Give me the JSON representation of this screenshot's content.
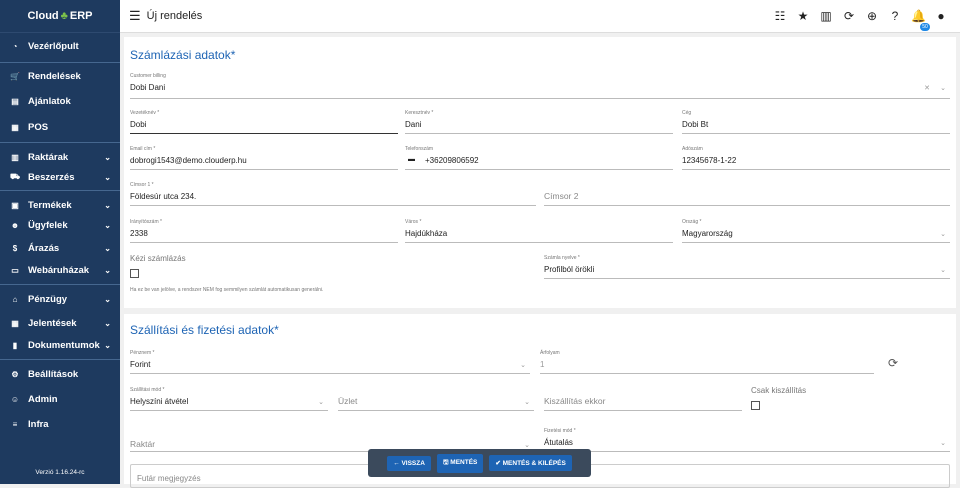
{
  "brand": {
    "name_left": "Cloud",
    "name_right": "ERP"
  },
  "sidebar": {
    "items": [
      {
        "label": "Vezérlőpult",
        "icon": "speedometer-icon"
      },
      {
        "label": "Rendelések",
        "icon": "cart-icon"
      },
      {
        "label": "Ajánlatok",
        "icon": "document-icon"
      },
      {
        "label": "POS",
        "icon": "pos-icon"
      },
      {
        "label": "Raktárak",
        "icon": "warehouse-icon"
      },
      {
        "label": "Beszerzés",
        "icon": "truck-icon"
      },
      {
        "label": "Termékek",
        "icon": "products-icon"
      },
      {
        "label": "Ügyfelek",
        "icon": "users-icon"
      },
      {
        "label": "Árazás",
        "icon": "dollar-icon"
      },
      {
        "label": "Webáruházak",
        "icon": "store-icon"
      },
      {
        "label": "Pénzügy",
        "icon": "bank-icon"
      },
      {
        "label": "Jelentések",
        "icon": "report-icon"
      },
      {
        "label": "Dokumentumok",
        "icon": "file-icon"
      },
      {
        "label": "Beállítások",
        "icon": "gear-icon"
      },
      {
        "label": "Admin",
        "icon": "admin-icon"
      },
      {
        "label": "Infra",
        "icon": "server-icon"
      }
    ],
    "version": "Verzió 1.16.24-rc"
  },
  "header": {
    "title": "Új rendelés",
    "notification_count": "50"
  },
  "billing": {
    "section_title": "Számlázási adatok*",
    "customer_label": "Customer billing",
    "customer_value": "Dobi Dani",
    "lastname_label": "Vezetéknév *",
    "lastname_value": "Dobi",
    "firstname_label": "Keresztnév *",
    "firstname_value": "Dani",
    "company_label": "Cég",
    "company_value": "Dobi Bt",
    "email_label": "Email cím *",
    "email_value": "dobrogi1543@demo.clouderp.hu",
    "phone_label": "Telefonszám",
    "phone_value": "+36209806592",
    "tax_label": "Adószám",
    "tax_value": "12345678-1-22",
    "addr1_label": "Címsor 1 *",
    "addr1_value": "Földesúr utca 234.",
    "addr2_placeholder": "Címsor 2",
    "zip_label": "Irányítószám *",
    "zip_value": "2338",
    "city_label": "Város *",
    "city_value": "Hajdúkháza",
    "country_label": "Ország *",
    "country_value": "Magyarország",
    "manual_label": "Kézi számlázás",
    "lang_label": "Számla nyelve *",
    "lang_value": "Profilból örökli",
    "hint": "Ha ez be van jelölve, a rendszer NEM fog semmilyen számlát automatikusan generálni."
  },
  "shipping": {
    "section_title": "Szállítási és fizetési adatok*",
    "currency_label": "Pénznem *",
    "currency_value": "Forint",
    "rate_label": "Árfolyam",
    "rate_value": "1",
    "method_label": "Szállítási mód *",
    "method_value": "Helyszíni átvétel",
    "shop_placeholder": "Üzlet",
    "when_placeholder": "Kiszállítás ekkor",
    "only_label": "Csak kiszállítás",
    "warehouse_placeholder": "Raktár",
    "payment_label": "Fizetési mód *",
    "payment_value": "Átutalás",
    "courier_placeholder": "Futár megjegyzés"
  },
  "actions": {
    "back": "← VISSZA",
    "save": "🖫 MENTÉS",
    "save_exit": "✔ MENTÉS & KILÉPÉS"
  }
}
